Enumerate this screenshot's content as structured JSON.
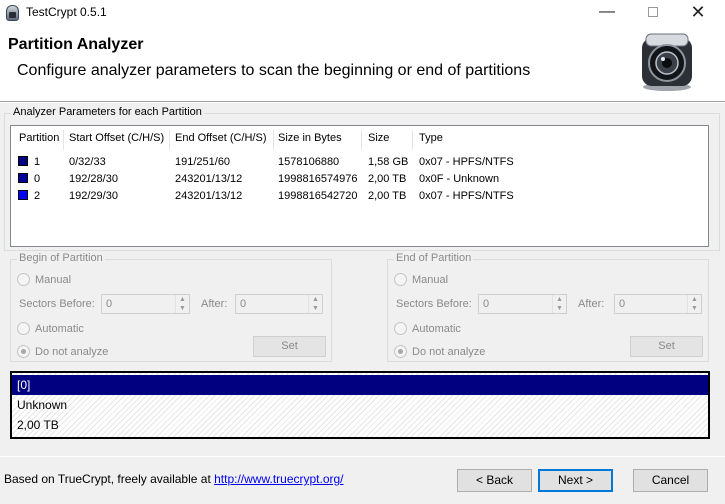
{
  "window": {
    "title": "TestCrypt 0.5.1"
  },
  "header": {
    "title": "Partition Analyzer",
    "subtitle": "Configure analyzer parameters to scan the beginning or end of partitions"
  },
  "params_group": {
    "label": "Analyzer Parameters for each Partition"
  },
  "partitions": {
    "columns": [
      "Partition",
      "Start Offset (C/H/S)",
      "End Offset (C/H/S)",
      "Size in Bytes",
      "Size",
      "Type"
    ],
    "rows": [
      {
        "color": "#000080",
        "partition": "1",
        "start": "0/32/33",
        "end": "191/251/60",
        "bytes": "1578106880",
        "size": "1,58 GB",
        "type": "0x07 - HPFS/NTFS"
      },
      {
        "color": "#00009a",
        "partition": "0",
        "start": "192/28/30",
        "end": "243201/13/12",
        "bytes": "1998816574976",
        "size": "2,00 TB",
        "type": "0x0F - Unknown"
      },
      {
        "color": "#0000ff",
        "partition": "2",
        "start": "192/29/30",
        "end": "243201/13/12",
        "bytes": "1998816542720",
        "size": "2,00 TB",
        "type": "0x07 - HPFS/NTFS"
      }
    ]
  },
  "begin": {
    "label": "Begin of Partition",
    "manual": "Manual",
    "sectors_before": "Sectors Before:",
    "sectors_before_value": "0",
    "after": "After:",
    "after_value": "0",
    "automatic": "Automatic",
    "do_not_analyze": "Do not analyze",
    "set": "Set"
  },
  "end": {
    "label": "End of Partition",
    "manual": "Manual",
    "sectors_before": "Sectors Before:",
    "sectors_before_value": "0",
    "after": "After:",
    "after_value": "0",
    "automatic": "Automatic",
    "do_not_analyze": "Do not analyze",
    "set": "Set"
  },
  "selection": {
    "line1": "[0]",
    "line2": "Unknown",
    "line3": "2,00 TB"
  },
  "footer": {
    "text": "Based on TrueCrypt, freely available at ",
    "link": "http://www.truecrypt.org/",
    "back": "< Back",
    "next": "Next >",
    "cancel": "Cancel"
  },
  "icons": {
    "app": "lock-icon",
    "header": "camera-lens-icon"
  },
  "colors": {
    "selection_bg": "#000080",
    "default_button_border": "#0078d7"
  }
}
